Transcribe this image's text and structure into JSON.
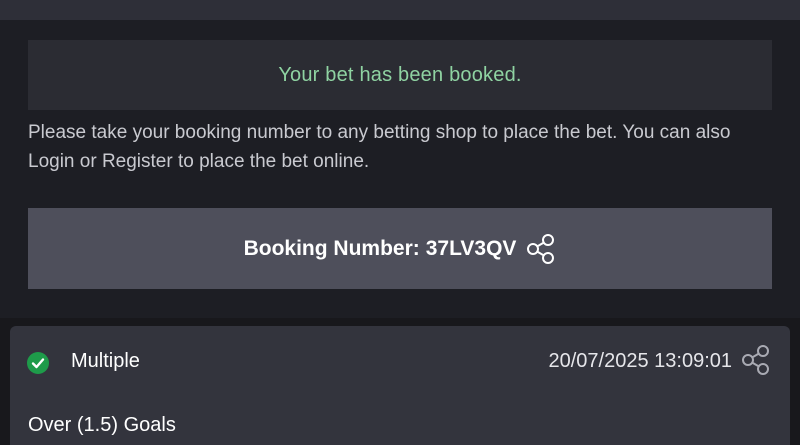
{
  "confirmation": {
    "message": "Your bet has been booked.",
    "info": "Please take your booking number to any betting shop to place the bet. You can also Login or Register to place the bet online.",
    "booking_label": "Booking Number:",
    "booking_code": "37LV3QV"
  },
  "bet_card": {
    "bet_type": "Multiple",
    "datetime": "20/07/2025 13:09:01",
    "selection": "Over (1.5) Goals"
  },
  "icons": {
    "booking_share": "share-icon",
    "card_share": "share-icon",
    "status": "check-circle-icon"
  },
  "colors": {
    "success_text": "#8fd3a2",
    "success_check": "#1e9b4a"
  }
}
